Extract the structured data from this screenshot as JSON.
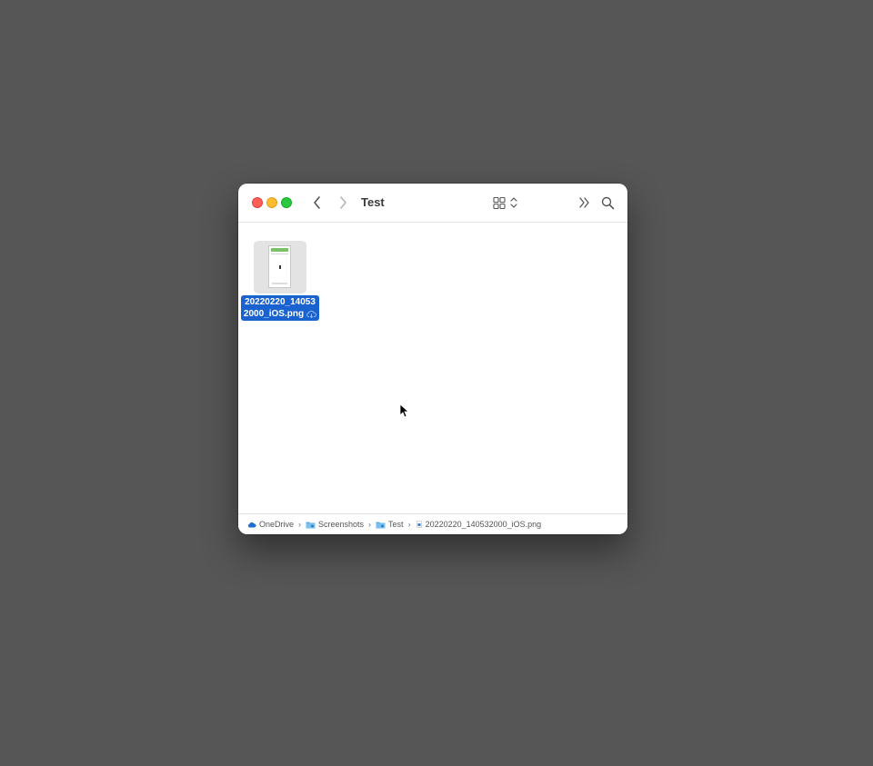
{
  "window": {
    "title": "Test"
  },
  "toolbar": {
    "back_icon": "chevron-left-icon",
    "forward_icon": "chevron-right-icon",
    "view_icon": "grid-view-icon",
    "more_icon": "double-chevron-right-icon",
    "search_icon": "search-icon"
  },
  "files": [
    {
      "name_line1": "20220220_14053",
      "name_line2": "2000_iOS.png",
      "selected": true,
      "cloud_status_icon": "cloud-download-icon"
    }
  ],
  "pathbar": {
    "items": [
      {
        "label": "OneDrive",
        "icon": "onedrive-icon"
      },
      {
        "label": "Screenshots",
        "icon": "folder-icon"
      },
      {
        "label": "Test",
        "icon": "folder-icon"
      },
      {
        "label": "20220220_140532000_iOS.png",
        "icon": "png-file-icon"
      }
    ]
  },
  "colors": {
    "desktop": "#565656",
    "selection": "#1a62cf",
    "close": "#fe5f57",
    "minimize": "#febc2e",
    "zoom": "#28c840"
  }
}
